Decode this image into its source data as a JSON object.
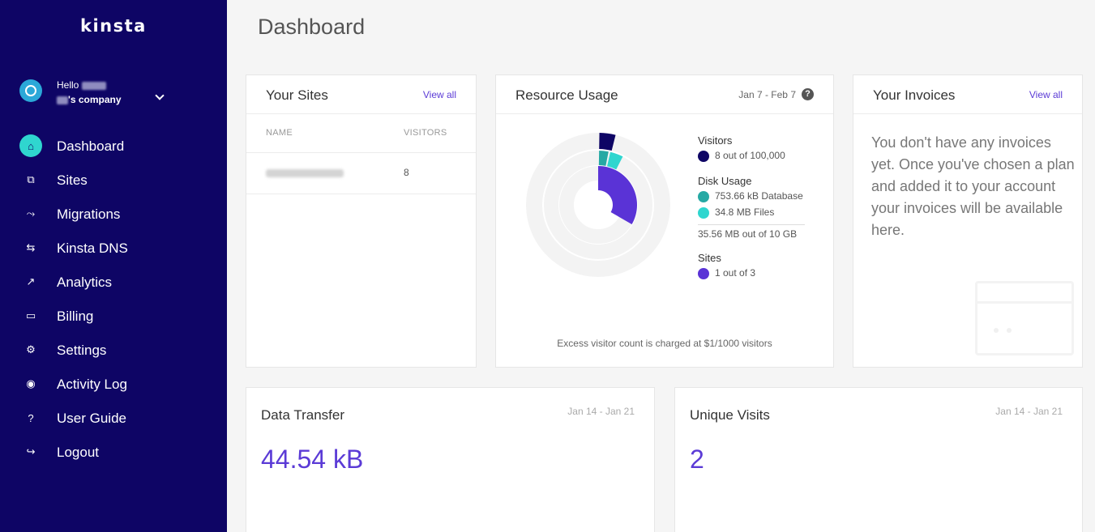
{
  "sidebar": {
    "logo": "kinsta",
    "user": {
      "hello": "Hello",
      "company_suffix": "'s company"
    },
    "nav": [
      {
        "label": "Dashboard",
        "icon": "home-icon",
        "glyph": "⌂",
        "active": true
      },
      {
        "label": "Sites",
        "icon": "sites-icon",
        "glyph": "⧉"
      },
      {
        "label": "Migrations",
        "icon": "migrations-icon",
        "glyph": "⤳"
      },
      {
        "label": "Kinsta DNS",
        "icon": "dns-icon",
        "glyph": "⇆"
      },
      {
        "label": "Analytics",
        "icon": "analytics-icon",
        "glyph": "↗"
      },
      {
        "label": "Billing",
        "icon": "billing-icon",
        "glyph": "▭"
      },
      {
        "label": "Settings",
        "icon": "settings-icon",
        "glyph": "⚙"
      },
      {
        "label": "Activity Log",
        "icon": "eye-icon",
        "glyph": "◉"
      },
      {
        "label": "User Guide",
        "icon": "help-circle-icon",
        "glyph": "?"
      },
      {
        "label": "Logout",
        "icon": "logout-icon",
        "glyph": "↪"
      }
    ]
  },
  "page": {
    "title": "Dashboard"
  },
  "sites_card": {
    "title": "Your Sites",
    "view_all": "View all",
    "columns": [
      "NAME",
      "VISITORS"
    ],
    "rows": [
      {
        "visitors": "8"
      }
    ]
  },
  "resource_card": {
    "title": "Resource Usage",
    "date_range": "Jan 7 - Feb 7",
    "help": "?",
    "visitors": {
      "title": "Visitors",
      "text": "8 out of 100,000",
      "value": 8,
      "max": 100000,
      "color": "#0e0565"
    },
    "disk": {
      "title": "Disk Usage",
      "database": {
        "text": "753.66 kB Database",
        "color": "#26a9a4"
      },
      "files": {
        "text": "34.8 MB Files",
        "color": "#2fd6cf"
      },
      "total": "35.56 MB out of 10 GB"
    },
    "sites": {
      "title": "Sites",
      "text": "1 out of 3",
      "value": 1,
      "max": 3,
      "color": "#5a33d6"
    },
    "note": "Excess visitor count is charged at $1/1000 visitors"
  },
  "invoices_card": {
    "title": "Your Invoices",
    "view_all": "View all",
    "empty_text": "You don't have any invoices yet. Once you've chosen a plan and added it to your account your invoices will be available here."
  },
  "data_transfer": {
    "title": "Data Transfer",
    "range": "Jan 14 - Jan 21",
    "value": "44.54 kB"
  },
  "unique_visits": {
    "title": "Unique Visits",
    "range": "Jan 14 - Jan 21",
    "value": "2"
  },
  "colors": {
    "sidebar": "#0e0565",
    "accent": "#5b3bd6",
    "teal": "#2fd6cf"
  }
}
